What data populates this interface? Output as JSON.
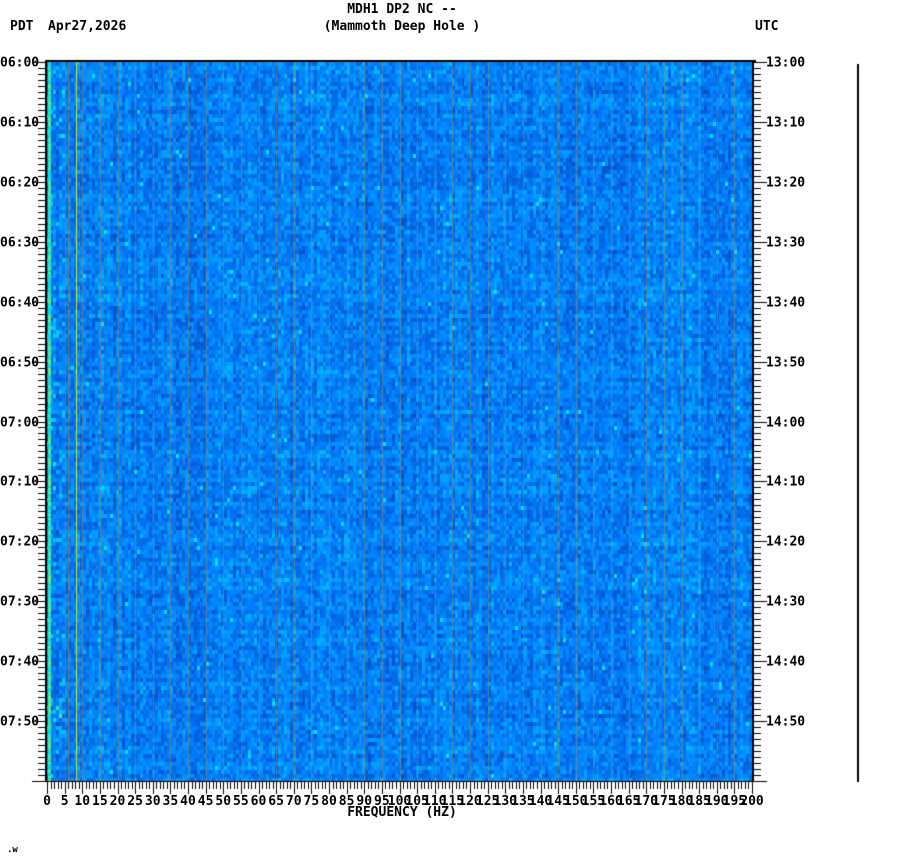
{
  "header": {
    "tz_left": "PDT",
    "date": "Apr27,2026",
    "title": "MDH1 DP2 NC --",
    "subtitle": "(Mammoth Deep Hole )",
    "tz_right": "UTC"
  },
  "corner_mark": ".w",
  "chart_data": {
    "type": "heatmap",
    "title": "MDH1 DP2 NC -- (Mammoth Deep Hole )",
    "xlabel": "FREQUENCY (HZ)",
    "x_range_hz": [
      0,
      200
    ],
    "x_minor_tick_step_hz": 1,
    "x_label_step_hz": 5,
    "x_tick_labels": [
      "0",
      "5",
      "10",
      "15",
      "20",
      "25",
      "30",
      "35",
      "40",
      "45",
      "50",
      "55",
      "60",
      "65",
      "70",
      "75",
      "80",
      "85",
      "90",
      "95",
      "100",
      "105",
      "110",
      "115",
      "120",
      "125",
      "130",
      "135",
      "140",
      "145",
      "150",
      "155",
      "160",
      "165",
      "170",
      "175",
      "180",
      "185",
      "190",
      "195",
      "200"
    ],
    "time_axis": {
      "span_minutes": 120,
      "minor_tick_minutes": 1,
      "major_tick_minutes": 10,
      "left_tz": "PDT",
      "left_labels": [
        "06:00",
        "06:10",
        "06:20",
        "06:30",
        "06:40",
        "06:50",
        "07:00",
        "07:10",
        "07:20",
        "07:30",
        "07:40",
        "07:50"
      ],
      "right_tz": "UTC",
      "right_labels": [
        "13:00",
        "13:10",
        "13:20",
        "13:30",
        "13:40",
        "13:50",
        "14:00",
        "14:10",
        "14:20",
        "14:30",
        "14:40",
        "14:50"
      ]
    },
    "legend_position": "none",
    "grid": {
      "vertical_every_hz": 5,
      "color": "rgba(200,140,60,0.45)"
    },
    "palette": {
      "noise_blues": [
        "#0054cc",
        "#0060dc",
        "#006ce8",
        "#0078f4",
        "#0084ff",
        "#0090ff",
        "#00a0ff",
        "#00b4ff",
        "#00c8ff"
      ],
      "rare_bright": "#00e0ff",
      "edge_strip_greens": [
        "#58e890",
        "#38e0b8",
        "#20d8d0",
        "#68ef78",
        "#00e0e0",
        "#30e8c0"
      ],
      "low_green_specks": [
        "#30e0a0",
        "#50e878"
      ],
      "yellow_line": "#d8d820",
      "warm_faint_line": "rgba(176,128,48,0.6)",
      "axis_color": "#000000"
    },
    "features": [
      {
        "name": "broadband-noise",
        "desc": "uniform random blue background noise across 0-200 Hz for full 2-hour window"
      },
      {
        "name": "low-frequency-edge-band",
        "hz_from": 0,
        "hz_to": 1,
        "desc": "bright green-cyan vertical band at lowest frequencies"
      },
      {
        "name": "narrowband-yellow-line",
        "hz": 8,
        "desc": "persistent bright yellow spectral line"
      },
      {
        "name": "narrowband-warm-line",
        "hz": 6,
        "desc": "fainter warm-colored spectral line"
      },
      {
        "name": "grid-lines",
        "desc": "faint olive vertical lines every 5 Hz"
      },
      {
        "name": "green-specks-low-freq-late",
        "desc": "scattered green-cyan cells below ~5 Hz near the end of the window"
      }
    ],
    "scale_bar": {
      "desc": "vertical black reference line right of plot"
    }
  }
}
